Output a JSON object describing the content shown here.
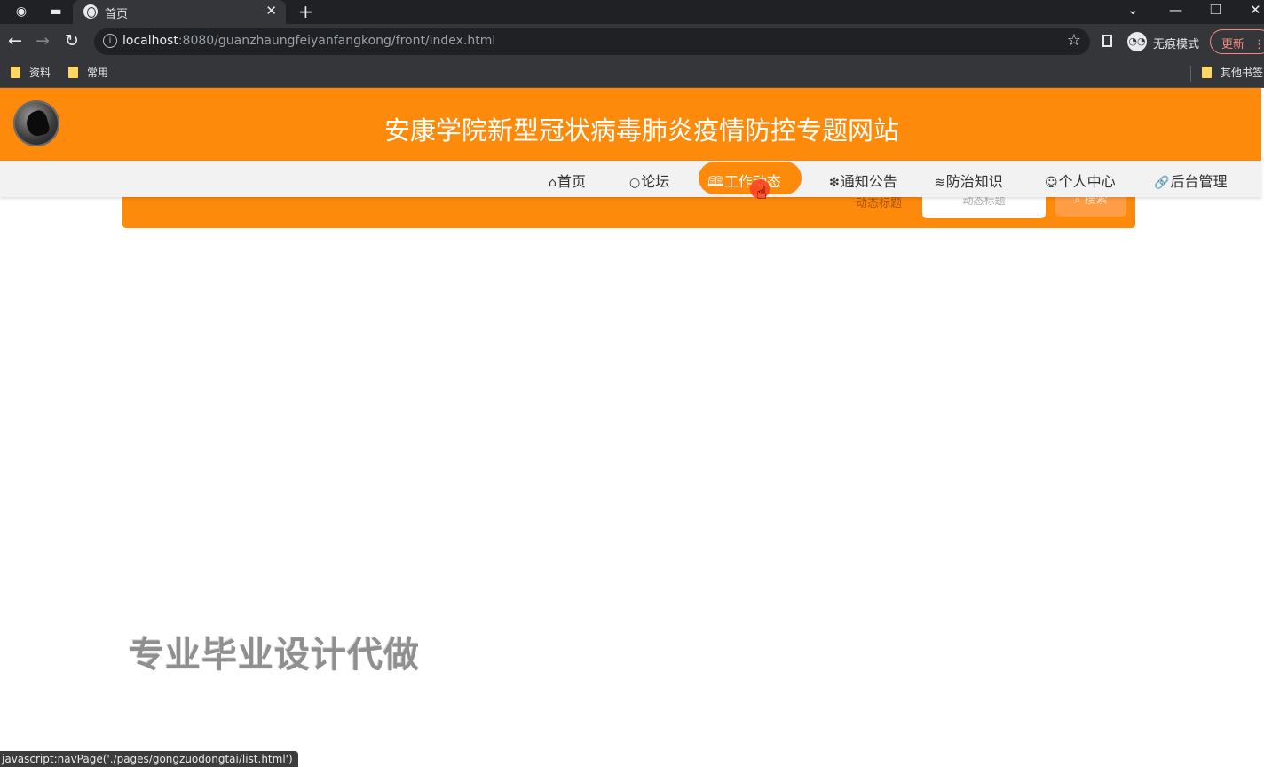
{
  "browser": {
    "tab_title": "首页",
    "url_host": "localhost",
    "url_rest": ":8080/guanzhaungfeiyanfangkong/front/index.html",
    "incognito_label": "无痕模式",
    "update_label": "更新",
    "bookmarks": [
      "资料",
      "常用"
    ],
    "other_bookmarks": "其他书签"
  },
  "site": {
    "title": "安康学院新型冠状病毒肺炎疫情防控专题网站"
  },
  "nav": {
    "items": [
      {
        "icon": "⌂",
        "label": "首页"
      },
      {
        "icon": "○",
        "label": "论坛"
      },
      {
        "icon": "🕮",
        "label": "工作动态"
      },
      {
        "icon": "❇",
        "label": "通知公告"
      },
      {
        "icon": "≋",
        "label": "防治知识"
      },
      {
        "icon": "☺",
        "label": "个人中心"
      },
      {
        "icon": "🔗",
        "label": "后台管理"
      }
    ],
    "active_index": 2
  },
  "search": {
    "label": "动态标题",
    "placeholder": "动态标题",
    "button_label": "搜索"
  },
  "watermark": "专业毕业设计代做",
  "status_text": "javascript:navPage('./pages/gongzuodongtai/list.html')",
  "colors": {
    "accent": "#fd8a0b",
    "nav_bg": "#f2f2f2"
  }
}
